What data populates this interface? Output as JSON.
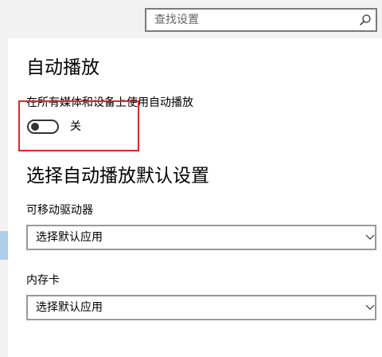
{
  "search": {
    "placeholder": "查找设置"
  },
  "autoplay": {
    "title": "自动播放",
    "toggle_label": "在所有媒体和设备上使用自动播放",
    "toggle_state": "关",
    "toggle_on": false
  },
  "defaults": {
    "title": "选择自动播放默认设置",
    "removable_drive": {
      "label": "可移动驱动器",
      "value": "选择默认应用"
    },
    "memory_card": {
      "label": "内存卡",
      "value": "选择默认应用"
    }
  },
  "colors": {
    "highlight_box": "#e0262c",
    "nav_accent": "#aecde8"
  },
  "icons": {
    "search": "search-icon",
    "dropdown": "chevron-down-icon"
  }
}
